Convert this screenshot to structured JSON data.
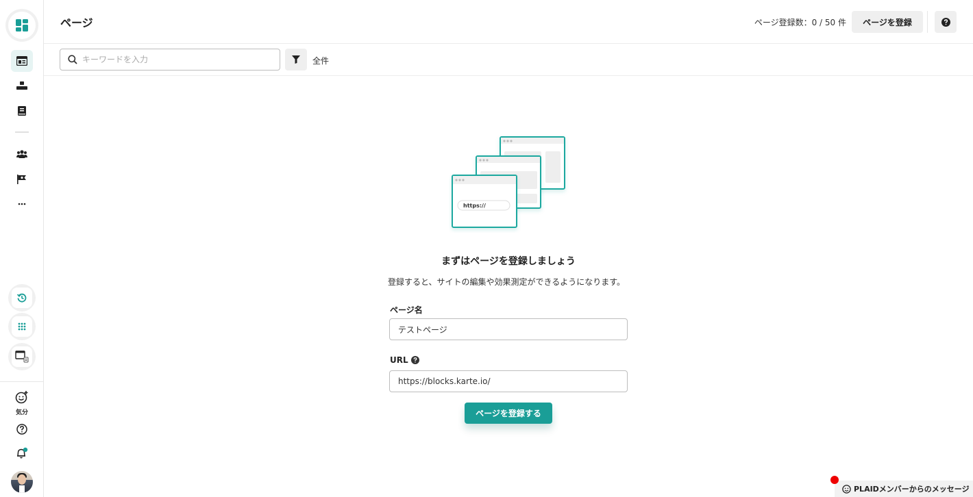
{
  "header": {
    "title": "ページ",
    "count_text": "ページ登録数：0 / 50 件",
    "register_button": "ページを登録"
  },
  "toolbar": {
    "search_placeholder": "キーワードを入力",
    "filter_label": "全件"
  },
  "sidebar": {
    "mood_label": "気分"
  },
  "empty_state": {
    "title": "まずはページを登録しましょう",
    "description": "登録すると、サイトの編集や効果測定ができるようになります。",
    "illustration_url_text": "https://"
  },
  "form": {
    "page_name_label": "ページ名",
    "page_name_value": "テストページ",
    "url_label": "URL",
    "url_value": "https://blocks.karte.io/",
    "submit_label": "ページを登録する"
  },
  "chat": {
    "label": "PLAIDメンバーからのメッセージ"
  },
  "colors": {
    "accent": "#1a9e97",
    "notification_dot": "#e00000"
  }
}
